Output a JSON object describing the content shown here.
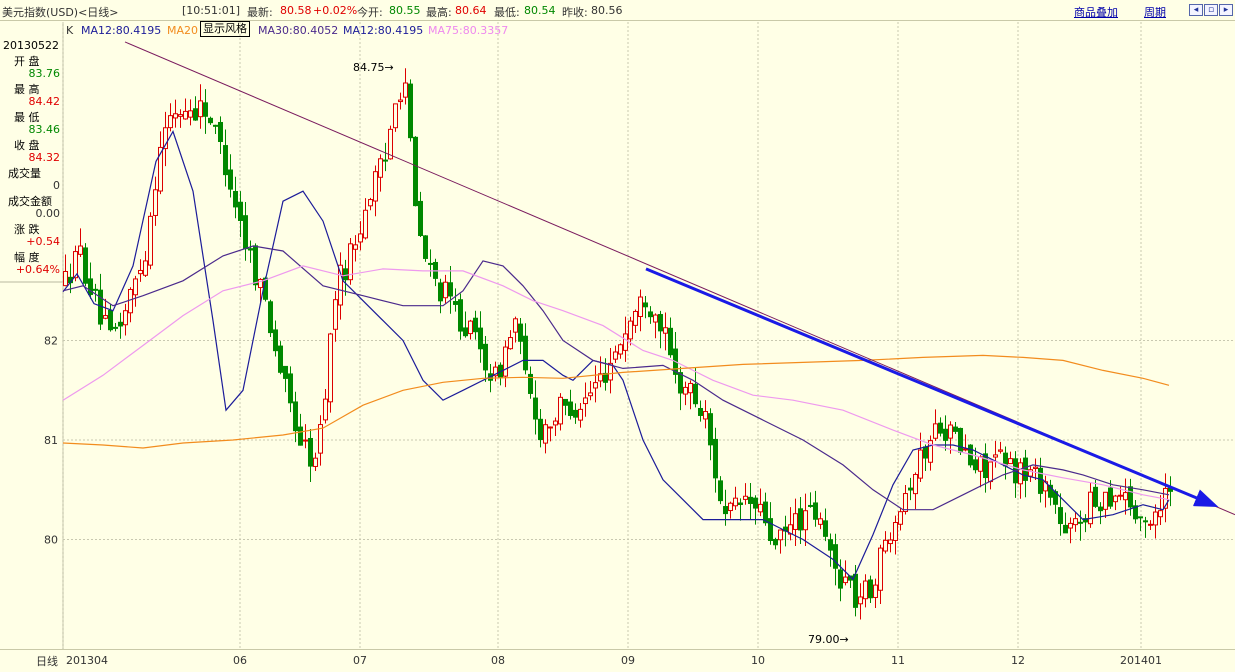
{
  "topbar": {
    "instrument": "美元指数(USD)<日线>",
    "time": "[10:51:01]",
    "latest_label": "最新:",
    "latest_value": "80.58",
    "change": "+0.02%",
    "open_label": "今开:",
    "open_value": "80.55",
    "high_label": "最高:",
    "high_value": "80.64",
    "low_label": "最低:",
    "low_value": "80.54",
    "prev_label": "昨收:",
    "prev_value": "80.56",
    "overlay_link": "商品叠加",
    "period_link": "周期"
  },
  "tooltip": "显示风格",
  "ma_legend": {
    "k": "K",
    "ma12": "MA12:80.4195",
    "ma20": "MA20",
    "ma30": "MA30:80.4052",
    "ma12b": "MA12:80.4195",
    "ma75": "MA75:80.3357"
  },
  "colors": {
    "up": "#DD0000",
    "down": "#008800",
    "ma12": "#1C1C99",
    "ma30": "#4B2A8C",
    "ma75": "#EE99EE",
    "ma200": "#F28C1E",
    "trend_bold": "#1A1AE6",
    "trend_thin": "#7A1B5E"
  },
  "left_panel": {
    "date": "20130522",
    "open_label": "开  盘",
    "open_value": "83.76",
    "high_label": "最  高",
    "high_value": "84.42",
    "low_label": "最  低",
    "low_value": "83.46",
    "close_label": "收  盘",
    "close_value": "84.32",
    "volume_label": "成交量",
    "volume_value": "0",
    "amount_label": "成交金额",
    "amount_value": "0.00",
    "change_label": "涨  跌",
    "change_value": "+0.54",
    "pct_label": "幅  度",
    "pct_value": "+0.64%"
  },
  "bottom_label": "日线",
  "chart_data": {
    "type": "candlestick",
    "x_tick_labels": [
      "201304",
      "06",
      "07",
      "08",
      "09",
      "10",
      "11",
      "12",
      "201401"
    ],
    "y_tick_labels": [
      "82",
      "81",
      "80"
    ],
    "ylim": [
      78.9,
      85.05
    ],
    "annotations": [
      {
        "text": "84.75",
        "value": 84.75,
        "note": "high"
      },
      {
        "text": "79.00",
        "value": 79.0,
        "note": "low"
      }
    ],
    "grid": true,
    "series": [
      {
        "name": "MA12",
        "type": "line",
        "points": [
          [
            0,
            82.49
          ],
          [
            14,
            82.67
          ],
          [
            31,
            82.37
          ],
          [
            50,
            82.3
          ],
          [
            70,
            82.75
          ],
          [
            93,
            83.8
          ],
          [
            110,
            84.1
          ],
          [
            130,
            83.5
          ],
          [
            150,
            82.2
          ],
          [
            163,
            81.3
          ],
          [
            180,
            81.5
          ],
          [
            200,
            82.5
          ],
          [
            220,
            83.4
          ],
          [
            240,
            83.5
          ],
          [
            260,
            83.2
          ],
          [
            280,
            82.6
          ],
          [
            300,
            82.4
          ],
          [
            320,
            82.2
          ],
          [
            340,
            82.0
          ],
          [
            360,
            81.6
          ],
          [
            380,
            81.4
          ],
          [
            400,
            81.5
          ],
          [
            420,
            81.6
          ],
          [
            440,
            81.7
          ],
          [
            460,
            81.8
          ],
          [
            480,
            81.8
          ],
          [
            500,
            81.65
          ],
          [
            510,
            81.6
          ],
          [
            530,
            81.8
          ],
          [
            550,
            81.75
          ],
          [
            560,
            81.6
          ],
          [
            580,
            81.0
          ],
          [
            600,
            80.6
          ],
          [
            620,
            80.4
          ],
          [
            640,
            80.2
          ],
          [
            660,
            80.2
          ],
          [
            680,
            80.2
          ],
          [
            700,
            80.2
          ],
          [
            720,
            80.1
          ],
          [
            740,
            80.0
          ],
          [
            770,
            79.8
          ],
          [
            790,
            79.6
          ],
          [
            810,
            80.05
          ],
          [
            830,
            80.55
          ],
          [
            850,
            80.9
          ],
          [
            870,
            80.95
          ],
          [
            890,
            80.95
          ],
          [
            910,
            80.9
          ],
          [
            930,
            80.8
          ],
          [
            960,
            80.65
          ],
          [
            980,
            80.6
          ],
          [
            1000,
            80.4
          ],
          [
            1020,
            80.2
          ],
          [
            1050,
            80.25
          ],
          [
            1080,
            80.35
          ],
          [
            1100,
            80.3
          ],
          [
            1106,
            80.4
          ]
        ]
      },
      {
        "name": "MA30",
        "type": "line",
        "points": [
          [
            0,
            82.5
          ],
          [
            20,
            82.55
          ],
          [
            50,
            82.35
          ],
          [
            80,
            82.45
          ],
          [
            120,
            82.6
          ],
          [
            160,
            82.85
          ],
          [
            190,
            82.95
          ],
          [
            220,
            82.9
          ],
          [
            260,
            82.55
          ],
          [
            300,
            82.45
          ],
          [
            340,
            82.35
          ],
          [
            380,
            82.35
          ],
          [
            400,
            82.5
          ],
          [
            420,
            82.8
          ],
          [
            440,
            82.75
          ],
          [
            460,
            82.55
          ],
          [
            480,
            82.3
          ],
          [
            500,
            82.0
          ],
          [
            530,
            81.8
          ],
          [
            560,
            81.72
          ],
          [
            600,
            81.75
          ],
          [
            630,
            81.6
          ],
          [
            660,
            81.4
          ],
          [
            700,
            81.2
          ],
          [
            740,
            81.0
          ],
          [
            780,
            80.75
          ],
          [
            810,
            80.5
          ],
          [
            840,
            80.3
          ],
          [
            870,
            80.3
          ],
          [
            900,
            80.45
          ],
          [
            940,
            80.65
          ],
          [
            970,
            80.75
          ],
          [
            1000,
            80.7
          ],
          [
            1020,
            80.65
          ],
          [
            1050,
            80.55
          ],
          [
            1080,
            80.5
          ],
          [
            1106,
            80.45
          ]
        ]
      },
      {
        "name": "MA75",
        "type": "line",
        "points": [
          [
            0,
            81.4
          ],
          [
            40,
            81.65
          ],
          [
            80,
            81.95
          ],
          [
            120,
            82.25
          ],
          [
            160,
            82.5
          ],
          [
            200,
            82.6
          ],
          [
            240,
            82.75
          ],
          [
            280,
            82.65
          ],
          [
            320,
            82.72
          ],
          [
            360,
            82.7
          ],
          [
            400,
            82.7
          ],
          [
            440,
            82.55
          ],
          [
            470,
            82.4
          ],
          [
            500,
            82.3
          ],
          [
            540,
            82.15
          ],
          [
            580,
            81.9
          ],
          [
            610,
            81.8
          ],
          [
            650,
            81.6
          ],
          [
            690,
            81.45
          ],
          [
            730,
            81.4
          ],
          [
            780,
            81.3
          ],
          [
            830,
            81.1
          ],
          [
            870,
            80.95
          ],
          [
            910,
            80.85
          ],
          [
            960,
            80.7
          ],
          [
            1000,
            80.62
          ],
          [
            1040,
            80.55
          ],
          [
            1080,
            80.45
          ],
          [
            1106,
            80.4
          ]
        ]
      },
      {
        "name": "MA200",
        "type": "line",
        "points": [
          [
            0,
            80.97
          ],
          [
            40,
            80.95
          ],
          [
            80,
            80.92
          ],
          [
            120,
            80.97
          ],
          [
            170,
            81.0
          ],
          [
            220,
            81.05
          ],
          [
            260,
            81.12
          ],
          [
            300,
            81.35
          ],
          [
            340,
            81.5
          ],
          [
            380,
            81.58
          ],
          [
            420,
            81.62
          ],
          [
            460,
            81.63
          ],
          [
            500,
            81.62
          ],
          [
            560,
            81.68
          ],
          [
            620,
            81.72
          ],
          [
            680,
            81.76
          ],
          [
            740,
            81.78
          ],
          [
            800,
            81.8
          ],
          [
            860,
            81.83
          ],
          [
            920,
            81.85
          ],
          [
            960,
            81.83
          ],
          [
            1000,
            81.8
          ],
          [
            1040,
            81.7
          ],
          [
            1080,
            81.62
          ],
          [
            1106,
            81.55
          ]
        ]
      }
    ],
    "trendlines": [
      {
        "name": "thin-resistance",
        "from": [
          62,
          85.0
        ],
        "to": [
          1172,
          80.25
        ]
      },
      {
        "name": "bold-resistance",
        "from": [
          583,
          82.72
        ],
        "to": [
          1150,
          80.35
        ],
        "arrow": true
      }
    ]
  }
}
